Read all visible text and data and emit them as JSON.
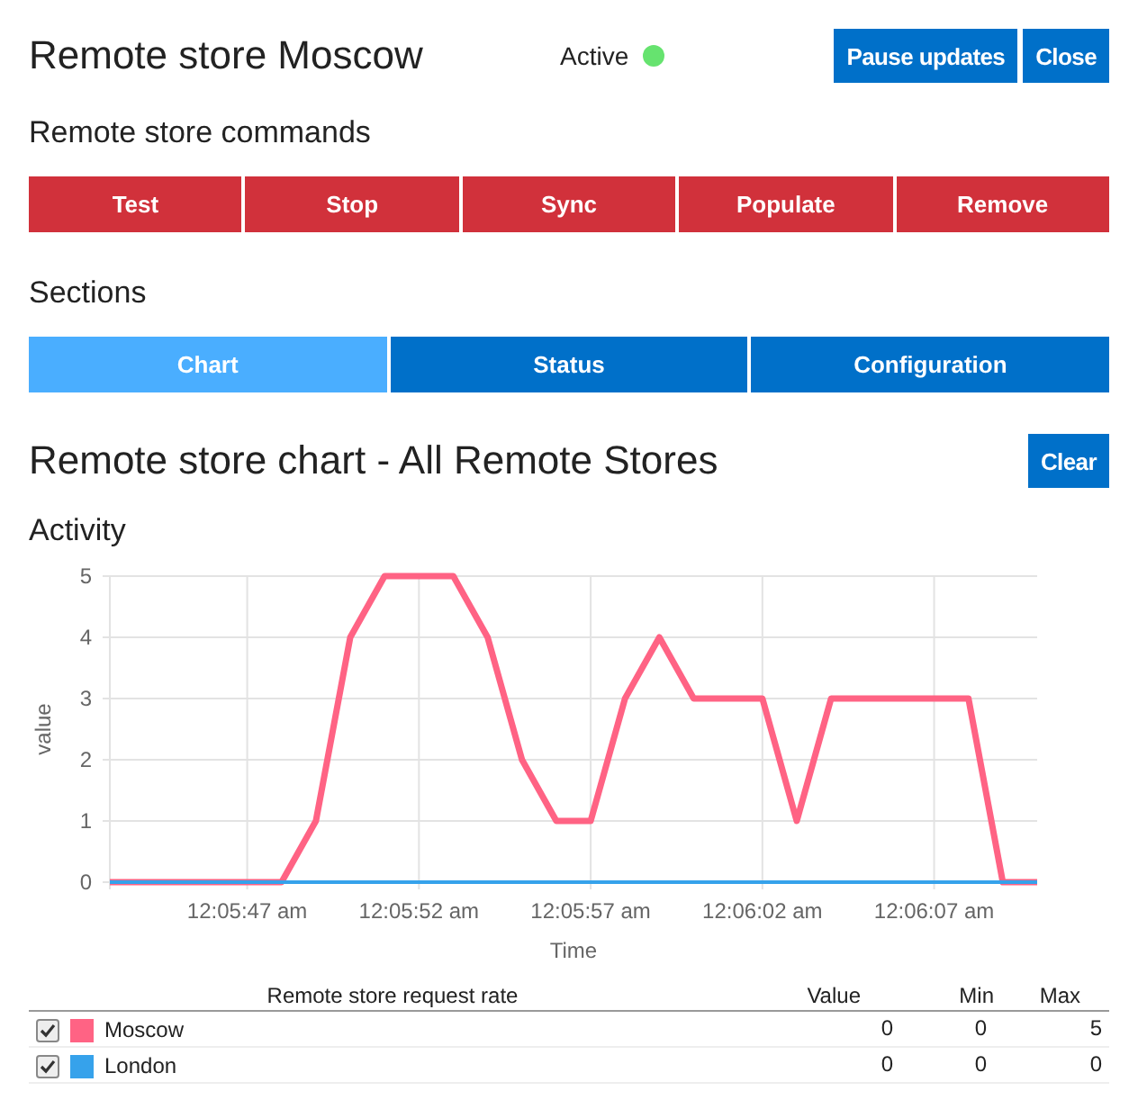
{
  "header": {
    "title": "Remote store Moscow",
    "status": {
      "label": "Active",
      "color": "#66e36f"
    },
    "buttons": [
      "Pause updates",
      "Close"
    ]
  },
  "commands": {
    "heading": "Remote store commands",
    "buttons": [
      "Test",
      "Stop",
      "Sync",
      "Populate",
      "Remove"
    ]
  },
  "sections": {
    "heading": "Sections",
    "tabs": [
      {
        "label": "Chart",
        "selected": true
      },
      {
        "label": "Status",
        "selected": false
      },
      {
        "label": "Configuration",
        "selected": false
      }
    ]
  },
  "chart_panel": {
    "title": "Remote store chart - All Remote Stores",
    "clear_button": "Clear",
    "subtitle": "Activity",
    "chart_data": {
      "type": "line",
      "xlabel": "Time",
      "ylabel": "value",
      "categories": [
        null,
        null,
        null,
        null,
        "12:05:47 am",
        null,
        null,
        null,
        null,
        "12:05:52 am",
        null,
        null,
        null,
        null,
        "12:05:57 am",
        null,
        null,
        null,
        null,
        "12:06:02 am",
        null,
        null,
        null,
        null,
        "12:06:07 am",
        null,
        null,
        null
      ],
      "series": [
        {
          "name": "Moscow",
          "color": "#ff6384",
          "values": [
            0,
            0,
            0,
            0,
            0,
            0,
            1,
            4,
            5,
            5,
            5,
            4,
            2,
            1,
            1,
            3,
            4,
            3,
            3,
            3,
            1,
            3,
            3,
            3,
            3,
            3,
            0,
            0
          ]
        },
        {
          "name": "London",
          "color": "#36a2eb",
          "values": [
            0,
            0,
            0,
            0,
            0,
            0,
            0,
            0,
            0,
            0,
            0,
            0,
            0,
            0,
            0,
            0,
            0,
            0,
            0,
            0,
            0,
            0,
            0,
            0,
            0,
            0,
            0,
            0
          ]
        }
      ],
      "ylim": [
        0,
        5
      ],
      "grid": true,
      "yticks": [
        0,
        1,
        2,
        3,
        4,
        5
      ]
    },
    "legend": {
      "columns": [
        "Remote store request rate",
        "Value",
        "Min",
        "Max"
      ],
      "rows": [
        {
          "checked": true,
          "value": "0",
          "min": "0",
          "max": "5"
        },
        {
          "checked": true,
          "value": "0",
          "min": "0",
          "max": "0"
        }
      ]
    }
  }
}
